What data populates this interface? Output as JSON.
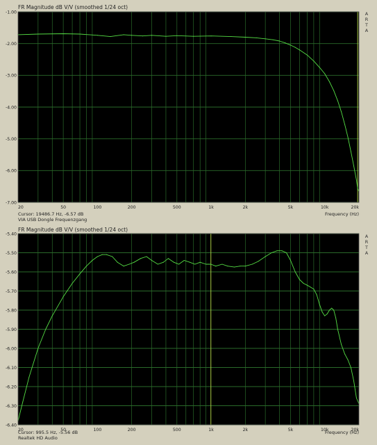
{
  "charts": [
    {
      "title": "FR Magnitude dB V/V (smoothed 1/24 oct)",
      "side_label": [
        "A",
        "R",
        "T",
        "A"
      ],
      "cursor": "Cursor: 19486.7 Hz, -6.57 dB",
      "name": "VIA USB Dongle Frequenzgang",
      "xlabel": "Frequency (Hz)"
    },
    {
      "title": "FR Magnitude dB V/V (smoothed 1/24 oct)",
      "side_label": [
        "A",
        "R",
        "T",
        "A"
      ],
      "cursor": "Cursor: 995.5 Hz, -5.56 dB",
      "name": "Realtek HD Audio",
      "xlabel": "Frequency (Hz)"
    }
  ],
  "colors": {
    "plot_bg": "#000000",
    "grid": "#2a6a2a",
    "trace": "#55dd44",
    "cursor": "#aacc44",
    "page_bg": "#d4d0bd"
  },
  "chart_data": [
    {
      "type": "line",
      "title": "FR Magnitude dB V/V (smoothed 1/24 oct)",
      "xlabel": "Frequency (Hz)",
      "ylabel": "",
      "x_scale": "log",
      "xlim": [
        20,
        20000
      ],
      "ylim": [
        -7.0,
        -1.0
      ],
      "xticks": [
        20,
        50,
        100,
        200,
        500,
        1000,
        2000,
        5000,
        10000,
        20000
      ],
      "xtick_labels": [
        "20",
        "50",
        "100",
        "200",
        "500",
        "1k",
        "2k",
        "5k",
        "10k",
        "20k"
      ],
      "yticks": [
        -1.0,
        -2.0,
        -3.0,
        -4.0,
        -5.0,
        -6.0,
        -7.0
      ],
      "ytick_labels": [
        "-1.00",
        "-2.00",
        "-3.00",
        "-4.00",
        "-5.00",
        "-6.00",
        "-7.00"
      ],
      "grid": true,
      "cursor_x": 19486.7,
      "series": [
        {
          "name": "VIA USB Dongle Frequenzgang",
          "x": [
            20,
            30,
            50,
            70,
            100,
            130,
            170,
            200,
            250,
            300,
            400,
            500,
            700,
            1000,
            1500,
            2000,
            2500,
            3000,
            3500,
            4000,
            4500,
            5000,
            5500,
            6000,
            7000,
            8000,
            9000,
            10000,
            11000,
            12000,
            13000,
            14000,
            15000,
            16000,
            17000,
            18000,
            19000,
            19486.7,
            20000
          ],
          "y": [
            -1.72,
            -1.7,
            -1.69,
            -1.7,
            -1.74,
            -1.78,
            -1.72,
            -1.74,
            -1.76,
            -1.74,
            -1.77,
            -1.75,
            -1.77,
            -1.76,
            -1.78,
            -1.8,
            -1.82,
            -1.85,
            -1.88,
            -1.92,
            -1.98,
            -2.05,
            -2.12,
            -2.2,
            -2.36,
            -2.55,
            -2.75,
            -2.95,
            -3.2,
            -3.48,
            -3.8,
            -4.15,
            -4.55,
            -4.95,
            -5.4,
            -5.85,
            -6.3,
            -6.57,
            -6.65
          ]
        }
      ]
    },
    {
      "type": "line",
      "title": "FR Magnitude dB V/V (smoothed 1/24 oct)",
      "xlabel": "Frequency (Hz)",
      "ylabel": "",
      "x_scale": "log",
      "xlim": [
        20,
        20000
      ],
      "ylim": [
        -6.4,
        -5.4
      ],
      "xticks": [
        20,
        50,
        100,
        200,
        500,
        1000,
        2000,
        5000,
        10000,
        20000
      ],
      "xtick_labels": [
        "20",
        "50",
        "100",
        "200",
        "500",
        "1k",
        "2k",
        "5k",
        "10k",
        "20k"
      ],
      "yticks": [
        -5.4,
        -5.5,
        -5.6,
        -5.7,
        -5.8,
        -5.9,
        -6.0,
        -6.1,
        -6.2,
        -6.3,
        -6.4
      ],
      "ytick_labels": [
        "-5.40",
        "-5.50",
        "-5.60",
        "-5.70",
        "-5.80",
        "-5.90",
        "-6.00",
        "-6.10",
        "-6.20",
        "-6.30",
        "-6.40"
      ],
      "grid": true,
      "cursor_x": 995.5,
      "series": [
        {
          "name": "Realtek HD Audio",
          "x": [
            20,
            22,
            25,
            30,
            35,
            40,
            50,
            60,
            70,
            80,
            90,
            100,
            110,
            120,
            135,
            150,
            170,
            190,
            210,
            240,
            270,
            300,
            340,
            380,
            420,
            470,
            520,
            580,
            650,
            720,
            800,
            900,
            995.5,
            1100,
            1250,
            1400,
            1600,
            1800,
            2000,
            2300,
            2600,
            3000,
            3400,
            3800,
            4200,
            4600,
            5000,
            5500,
            6000,
            6500,
            7000,
            7500,
            8000,
            8500,
            9000,
            9500,
            10000,
            10500,
            11000,
            11500,
            12000,
            12500,
            13000,
            14000,
            15000,
            16000,
            17000,
            18000,
            19000,
            20000
          ],
          "y": [
            -6.38,
            -6.28,
            -6.15,
            -6.0,
            -5.9,
            -5.83,
            -5.73,
            -5.66,
            -5.61,
            -5.57,
            -5.54,
            -5.52,
            -5.51,
            -5.51,
            -5.52,
            -5.55,
            -5.57,
            -5.56,
            -5.55,
            -5.53,
            -5.52,
            -5.54,
            -5.56,
            -5.55,
            -5.53,
            -5.55,
            -5.56,
            -5.54,
            -5.55,
            -5.56,
            -5.55,
            -5.56,
            -5.56,
            -5.57,
            -5.56,
            -5.57,
            -5.575,
            -5.57,
            -5.57,
            -5.56,
            -5.545,
            -5.52,
            -5.5,
            -5.49,
            -5.49,
            -5.5,
            -5.54,
            -5.6,
            -5.64,
            -5.66,
            -5.67,
            -5.68,
            -5.69,
            -5.72,
            -5.77,
            -5.81,
            -5.83,
            -5.82,
            -5.8,
            -5.79,
            -5.8,
            -5.84,
            -5.9,
            -5.98,
            -6.03,
            -6.06,
            -6.1,
            -6.17,
            -6.26,
            -6.29
          ]
        }
      ]
    }
  ]
}
